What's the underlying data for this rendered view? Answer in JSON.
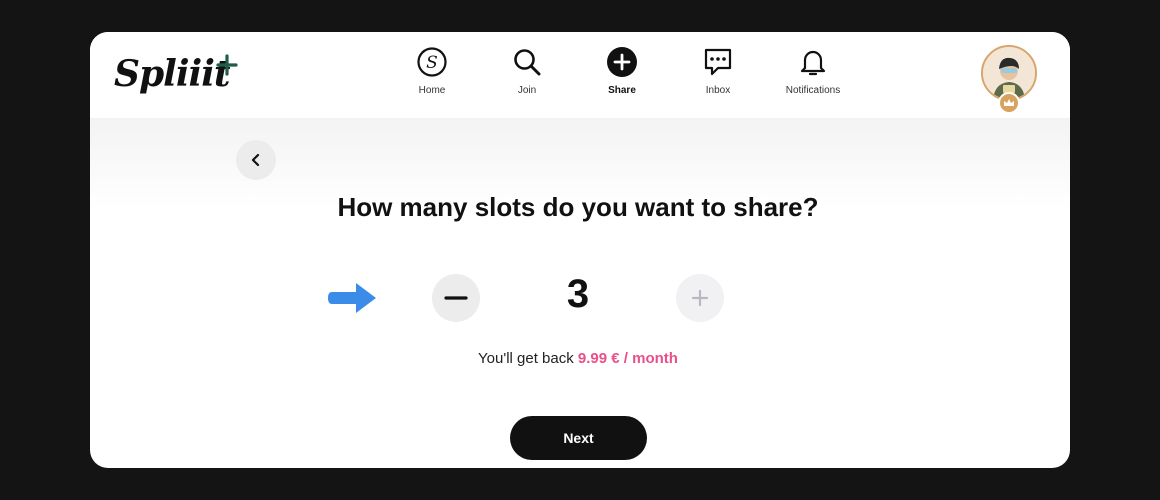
{
  "app": {
    "logo_text": "Spliiit",
    "brand_color": "#1f5c4a",
    "accent_color": "#e94f8a",
    "arrow_color": "#3b8be8"
  },
  "nav": {
    "items": [
      {
        "label": "Home",
        "icon": "s-circle-icon",
        "active": false
      },
      {
        "label": "Join",
        "icon": "search-icon",
        "active": false
      },
      {
        "label": "Share",
        "icon": "plus-circle-icon",
        "active": true
      },
      {
        "label": "Inbox",
        "icon": "chat-icon",
        "active": false
      },
      {
        "label": "Notifications",
        "icon": "bell-icon",
        "active": false
      }
    ]
  },
  "profile": {
    "avatar_icon": "user-avatar",
    "badge_icon": "crown-icon"
  },
  "page": {
    "back_icon": "chevron-left-icon",
    "title": "How many slots do you want to share?",
    "slots": "3",
    "refund_prefix": "You'll get back ",
    "refund_amount": "9.99 € / month",
    "next_label": "Next"
  }
}
